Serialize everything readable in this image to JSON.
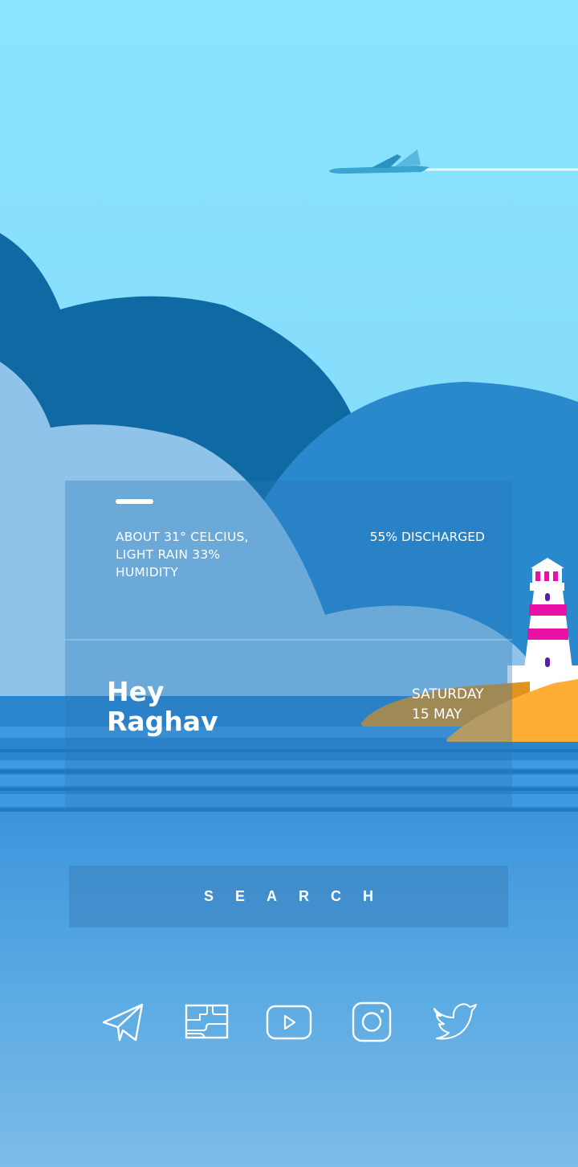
{
  "widget": {
    "weather_text": "ABOUT 31° CELCIUS, LIGHT RAIN 33% HUMIDITY",
    "battery_text": "55% DISCHARGED",
    "greeting_line1": "Hey",
    "greeting_line2": "Raghav",
    "date_line1": "SATURDAY",
    "date_line2": "15 MAY"
  },
  "search": {
    "label": "SEARCH"
  },
  "dock": {
    "icons": [
      "telegram-icon",
      "maps-icon",
      "youtube-icon",
      "instagram-icon",
      "twitter-icon"
    ]
  },
  "colors": {
    "sky": "#8ae4ff",
    "dark_hill": "#0f6aa3",
    "mid_hill": "#2a88cc",
    "light_hill": "#8fc3ea",
    "sea": "#2b86ce",
    "sand": "#ffae35",
    "lighthouse_stripe": "#ea12a6"
  }
}
